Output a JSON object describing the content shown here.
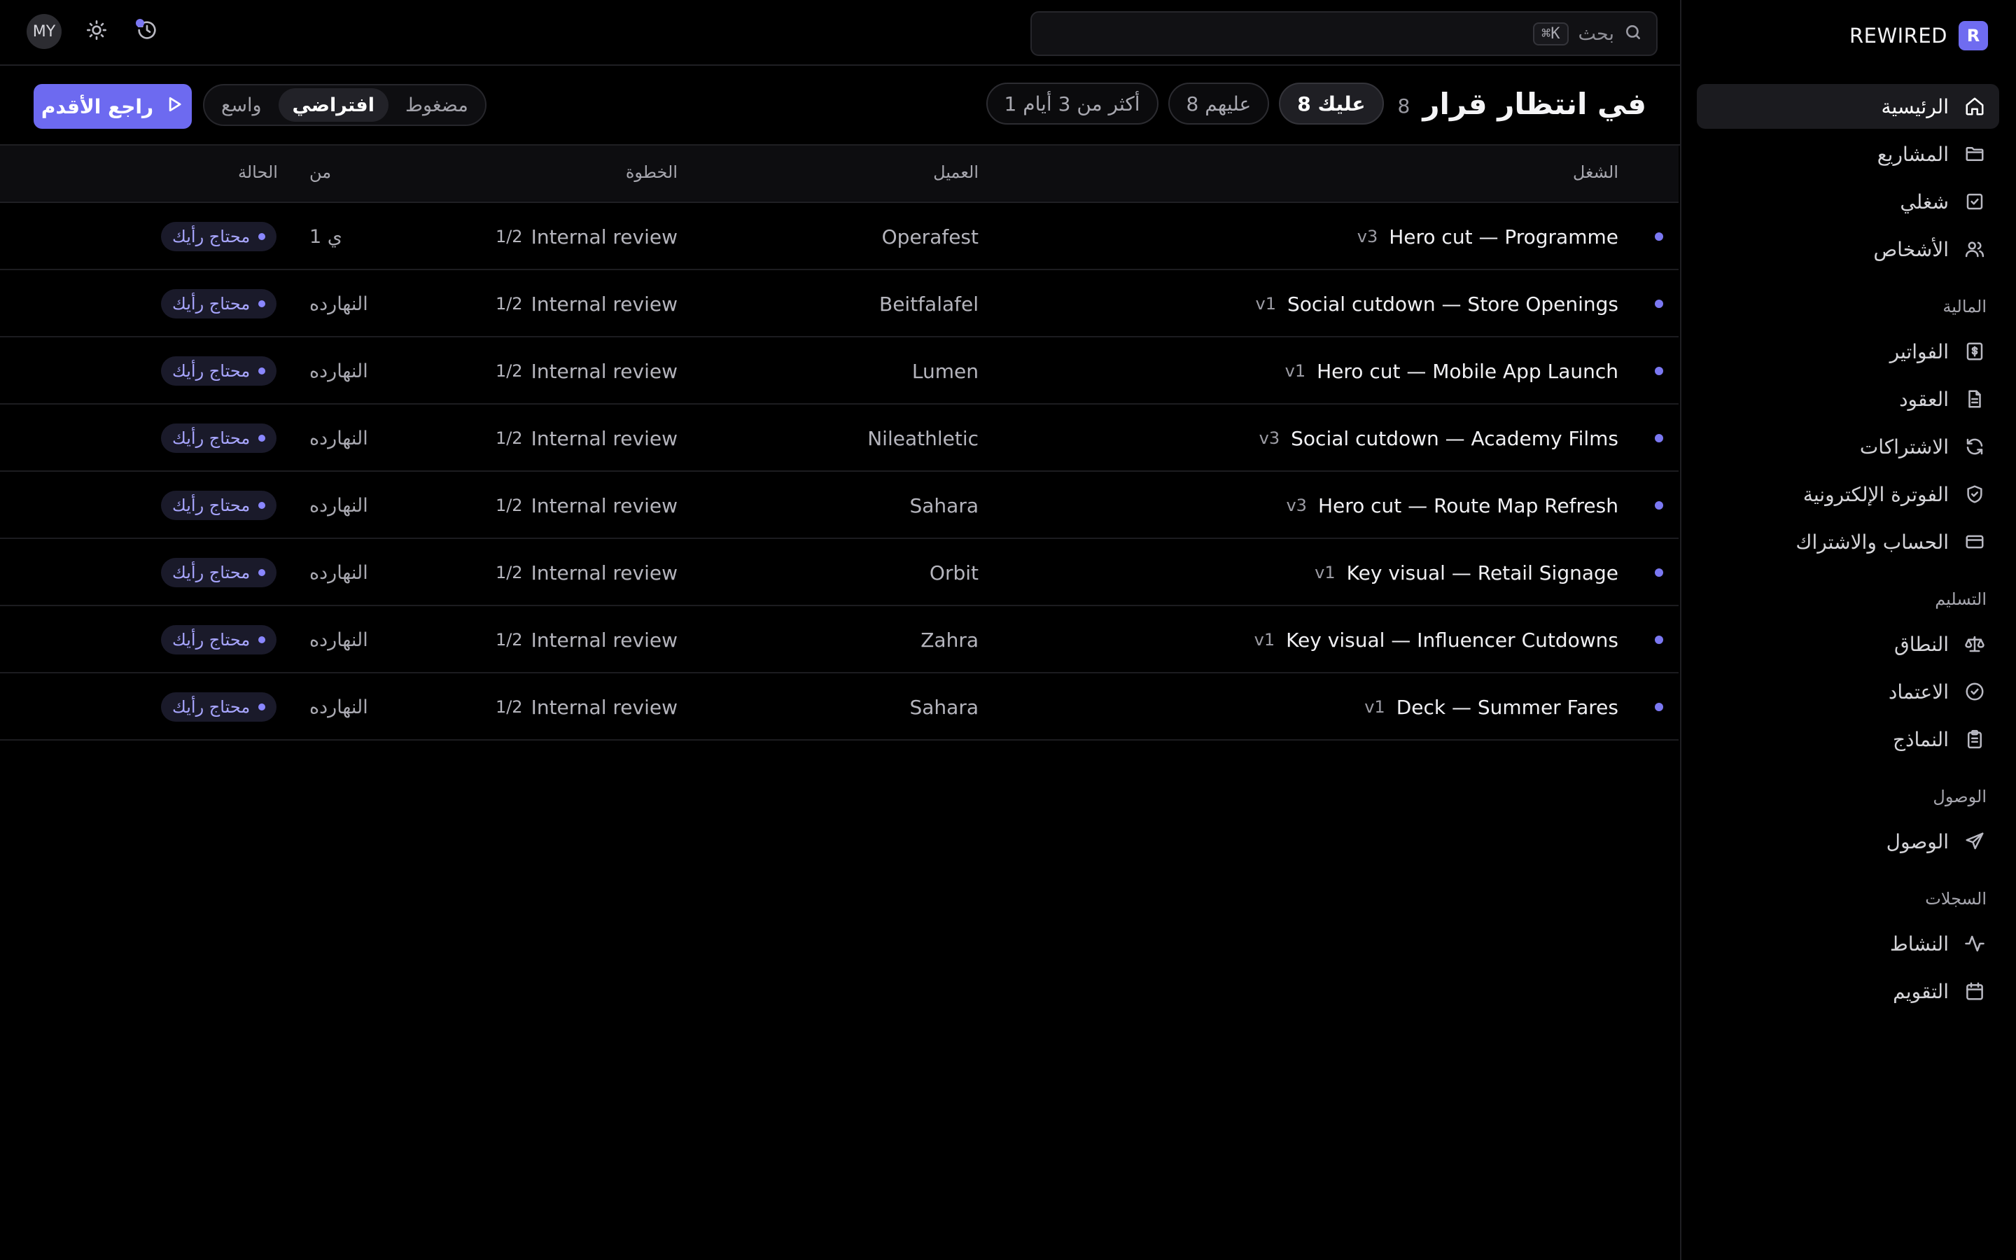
{
  "brand": {
    "badge": "R",
    "name": "REWIRED"
  },
  "sidebar": {
    "items": [
      {
        "label": "الرئيسية",
        "icon": "home-icon",
        "active": true
      },
      {
        "label": "المشاريع",
        "icon": "folder-icon"
      },
      {
        "label": "شغلي",
        "icon": "check-square-icon"
      },
      {
        "label": "الأشخاص",
        "icon": "users-icon"
      }
    ],
    "sections": [
      {
        "title": "المالية",
        "items": [
          {
            "label": "الفواتير",
            "icon": "invoice-icon"
          },
          {
            "label": "العقود",
            "icon": "document-icon"
          },
          {
            "label": "الاشتراكات",
            "icon": "refresh-icon"
          },
          {
            "label": "الفوترة الإلكترونية",
            "icon": "shield-icon"
          },
          {
            "label": "الحساب والاشتراك",
            "icon": "credit-card-icon"
          }
        ]
      },
      {
        "title": "التسليم",
        "items": [
          {
            "label": "النطاق",
            "icon": "scale-icon"
          },
          {
            "label": "الاعتماد",
            "icon": "check-circle-icon"
          },
          {
            "label": "النماذج",
            "icon": "clipboard-icon"
          }
        ]
      },
      {
        "title": "الوصول",
        "items": [
          {
            "label": "الوصول",
            "icon": "send-icon"
          }
        ]
      },
      {
        "title": "السجلات",
        "items": [
          {
            "label": "النشاط",
            "icon": "activity-icon"
          },
          {
            "label": "التقويم",
            "icon": "calendar-icon"
          }
        ]
      }
    ]
  },
  "topbar": {
    "search_placeholder": "بحث",
    "search_shortcut": "⌘K",
    "avatar": "MY"
  },
  "header": {
    "title": "في انتظار قرار",
    "count": "8",
    "filters": [
      {
        "label": "عليك 8",
        "active": true
      },
      {
        "label": "عليهم 8"
      },
      {
        "label": "أكثر من 3 أيام 1"
      }
    ],
    "density": [
      {
        "label": "مضغوط"
      },
      {
        "label": "افتراضي",
        "active": true
      },
      {
        "label": "واسع"
      }
    ],
    "cta_label": "راجع الأقدم"
  },
  "table": {
    "columns": {
      "work": "الشغل",
      "client": "العميل",
      "step": "الخطوة",
      "from": "من",
      "status": "الحالة"
    },
    "rows": [
      {
        "title": "Hero cut — Programme",
        "version": "v3",
        "client": "Operafest",
        "step": "Internal review",
        "step_frac": "1/2",
        "from": "1 ي",
        "status": "محتاج رأيك"
      },
      {
        "title": "Social cutdown — Store Openings",
        "version": "v1",
        "client": "Beitfalafel",
        "step": "Internal review",
        "step_frac": "1/2",
        "from": "النهارده",
        "status": "محتاج رأيك"
      },
      {
        "title": "Hero cut — Mobile App Launch",
        "version": "v1",
        "client": "Lumen",
        "step": "Internal review",
        "step_frac": "1/2",
        "from": "النهارده",
        "status": "محتاج رأيك"
      },
      {
        "title": "Social cutdown — Academy Films",
        "version": "v3",
        "client": "Nileathletic",
        "step": "Internal review",
        "step_frac": "1/2",
        "from": "النهارده",
        "status": "محتاج رأيك"
      },
      {
        "title": "Hero cut — Route Map Refresh",
        "version": "v3",
        "client": "Sahara",
        "step": "Internal review",
        "step_frac": "1/2",
        "from": "النهارده",
        "status": "محتاج رأيك"
      },
      {
        "title": "Key visual — Retail Signage",
        "version": "v1",
        "client": "Orbit",
        "step": "Internal review",
        "step_frac": "1/2",
        "from": "النهارده",
        "status": "محتاج رأيك"
      },
      {
        "title": "Key visual — Influencer Cutdowns",
        "version": "v1",
        "client": "Zahra",
        "step": "Internal review",
        "step_frac": "1/2",
        "from": "النهارده",
        "status": "محتاج رأيك"
      },
      {
        "title": "Deck — Summer Fares",
        "version": "v1",
        "client": "Sahara",
        "step": "Internal review",
        "step_frac": "1/2",
        "from": "النهارده",
        "status": "محتاج رأيك"
      }
    ]
  },
  "colors": {
    "accent": "#6d6af0",
    "background": "#000000",
    "status_text": "#a8a6ff"
  }
}
